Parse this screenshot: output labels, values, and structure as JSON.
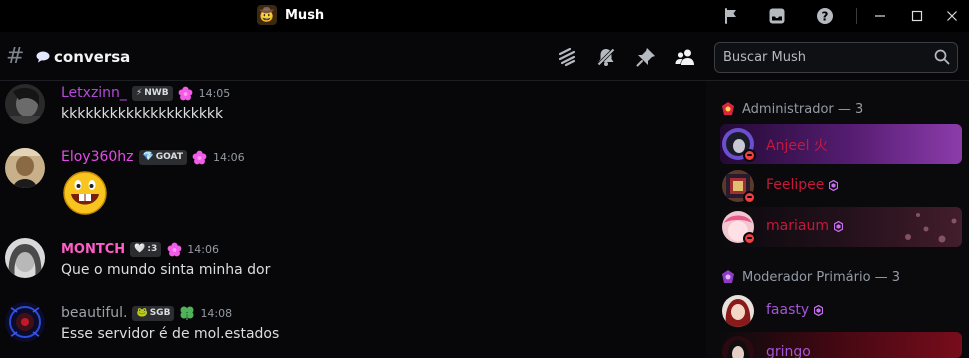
{
  "window": {
    "title": "Mush",
    "server_emoji": "🤠"
  },
  "channel": {
    "name": "conversa",
    "prefix_icon": "hash-icon",
    "name_icon": "speech-bubble-icon"
  },
  "search": {
    "placeholder": "Buscar Mush"
  },
  "messages": [
    {
      "username": "Letxzinn_",
      "name_color": "#b44bd8",
      "tag": "NWB",
      "tag_icon": "⚡",
      "badge": "pink-flower-icon",
      "time": "14:05",
      "text": "kkkkkkkkkkkkkkkkkkkk"
    },
    {
      "username": "Eloy360hz",
      "name_color": "#e64be8",
      "tag": "GOAT",
      "tag_icon": "💎",
      "badge": "pink-flower-icon",
      "time": "14:06",
      "text": "",
      "emoji": "grinning-face-emoji"
    },
    {
      "username": "MONTCH",
      "name_color": "#ff5ec8",
      "tag": ":3",
      "tag_icon": "🤍",
      "badge": "pink-flower-icon",
      "time": "14:06",
      "text": "Que o mundo sinta minha dor"
    },
    {
      "username": "beautiful.",
      "name_color": "#9da1a8",
      "tag": "SGB",
      "tag_icon": "🐸",
      "badge": "clover-icon",
      "time": "14:08",
      "text": "Esse servidor é de mol.estados"
    }
  ],
  "member_groups": [
    {
      "label": "Administrador — 3",
      "members": [
        {
          "name": "Anjeel 火",
          "color": "#c8173d"
        },
        {
          "name": "Feelipee",
          "color": "#c8173d"
        },
        {
          "name": "mariaum",
          "color": "#c8173d"
        }
      ]
    },
    {
      "label": "Moderador Primário — 3",
      "members": [
        {
          "name": "faasty",
          "color": "#a455d6"
        },
        {
          "name": "gringo",
          "color": "#a455d6"
        }
      ]
    }
  ]
}
